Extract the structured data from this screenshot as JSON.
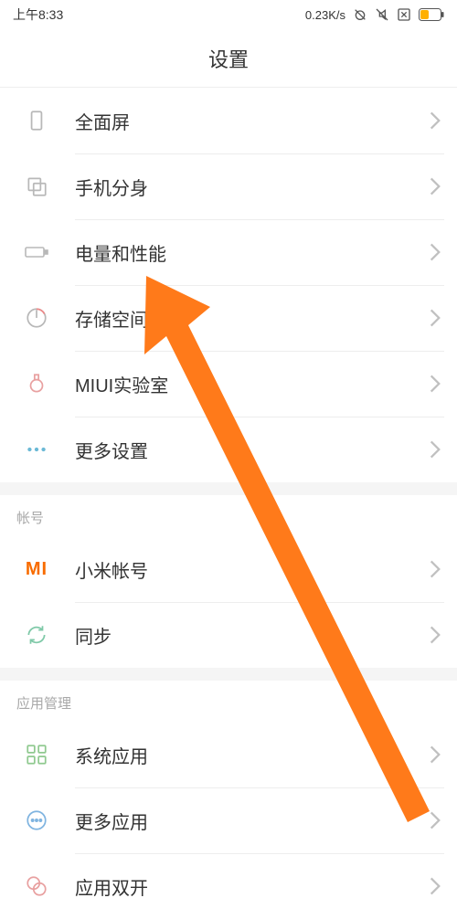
{
  "status": {
    "time": "上午8:33",
    "speed": "0.23K/s"
  },
  "title": "设置",
  "sections": [
    {
      "header": null,
      "items": [
        {
          "label": "全面屏",
          "icon": "fullscreen"
        },
        {
          "label": "手机分身",
          "icon": "dual"
        },
        {
          "label": "电量和性能",
          "icon": "battery"
        },
        {
          "label": "存储空间",
          "icon": "storage"
        },
        {
          "label": "MIUI实验室",
          "icon": "lab"
        },
        {
          "label": "更多设置",
          "icon": "more"
        }
      ]
    },
    {
      "header": "帐号",
      "items": [
        {
          "label": "小米帐号",
          "icon": "mi"
        },
        {
          "label": "同步",
          "icon": "sync"
        }
      ]
    },
    {
      "header": "应用管理",
      "items": [
        {
          "label": "系统应用",
          "icon": "grid"
        },
        {
          "label": "更多应用",
          "icon": "moreapps"
        },
        {
          "label": "应用双开",
          "icon": "dualapp"
        }
      ]
    }
  ],
  "annotation": {
    "type": "arrow",
    "color": "#ff7a1a",
    "target_item_label": "存储空间"
  }
}
